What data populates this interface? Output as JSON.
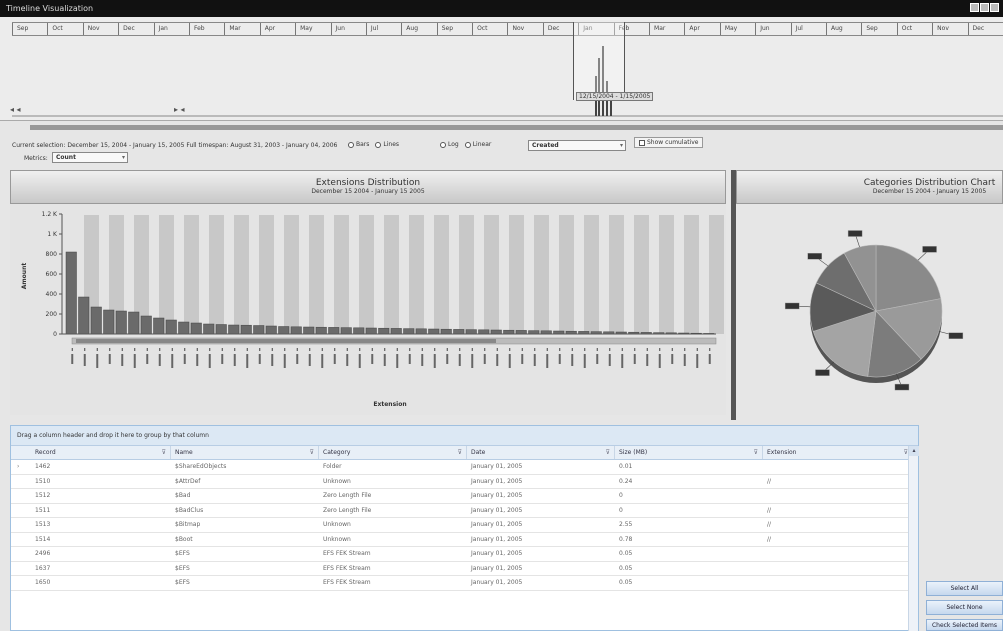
{
  "window": {
    "title": "Timeline Visualization"
  },
  "timeline": {
    "months": [
      "Sep",
      "Oct",
      "Nov",
      "Dec",
      "Jan",
      "Feb",
      "Mar",
      "Apr",
      "May",
      "Jun",
      "Jul",
      "Aug",
      "Sep",
      "Oct",
      "Nov",
      "Dec",
      "Jan",
      "Feb",
      "Mar",
      "Apr",
      "May",
      "Jun",
      "Jul",
      "Aug",
      "Sep",
      "Oct",
      "Nov",
      "Dec"
    ],
    "selection_label": "12/15/2004 - 1/15/2005",
    "arrows": {
      "left": "◂ ◂",
      "mid": "▸ ◂",
      "right": "▸"
    }
  },
  "controls": {
    "selection_text": "Current selection: December 15, 2004 - January 15, 2005   Full timespan: August 31, 2003 - January 04, 2006",
    "bar_options": [
      {
        "label": "Bars",
        "on": true
      },
      {
        "label": "Lines",
        "on": false
      }
    ],
    "scale_options": [
      {
        "label": "Log",
        "on": true
      },
      {
        "label": "Linear",
        "on": false
      }
    ],
    "date_field": "Created",
    "show_cumulative": "Show cumulative",
    "metrics_label": "Metrics:",
    "metrics_value": "Count"
  },
  "ext_chart": {
    "title": "Extensions Distribution",
    "subtitle": "December 15 2004 - January 15 2005",
    "ylabel": "Amount",
    "xlabel": "Extension"
  },
  "cat_chart": {
    "title": "Categories Distribution Chart",
    "subtitle": "December 15 2004 - January 15 2005"
  },
  "chart_data": {
    "type": "bar",
    "y_ticks": [
      "1.2 K",
      "1 K",
      "800",
      "600",
      "400",
      "200",
      "0"
    ],
    "ylim": [
      0,
      1200
    ],
    "values": [
      820,
      370,
      270,
      240,
      230,
      220,
      180,
      160,
      140,
      120,
      110,
      100,
      95,
      90,
      88,
      85,
      80,
      75,
      72,
      70,
      68,
      66,
      64,
      62,
      60,
      58,
      56,
      54,
      52,
      50,
      48,
      46,
      44,
      42,
      40,
      38,
      36,
      34,
      32,
      30,
      28,
      26,
      24,
      22,
      20,
      18,
      16,
      14,
      12,
      10,
      8,
      6
    ]
  },
  "pie": {
    "slices": [
      0.22,
      0.16,
      0.14,
      0.18,
      0.12,
      0.1,
      0.08
    ]
  },
  "grid": {
    "group_hint": "Drag a column header and drop it here to group by that column",
    "columns": [
      "Record",
      "Name",
      "Category",
      "Date",
      "Size (MB)",
      "Extension"
    ],
    "rows": [
      [
        "1462",
        "$ShareEdObjects",
        "Folder",
        "January 01, 2005",
        "0.01",
        ""
      ],
      [
        "1510",
        "$AttrDef",
        "Unknown",
        "January 01, 2005",
        "0.24",
        "//"
      ],
      [
        "1512",
        "$Bad",
        "Zero Length File",
        "January 01, 2005",
        "0",
        ""
      ],
      [
        "1511",
        "$BadClus",
        "Zero Length File",
        "January 01, 2005",
        "0",
        "//"
      ],
      [
        "1513",
        "$Bitmap",
        "Unknown",
        "January 01, 2005",
        "2.55",
        "//"
      ],
      [
        "1514",
        "$Boot",
        "Unknown",
        "January 01, 2005",
        "0.78",
        "//"
      ],
      [
        "2496",
        "$EFS",
        "EFS FEK Stream",
        "January 01, 2005",
        "0.05",
        ""
      ],
      [
        "1637",
        "$EFS",
        "EFS FEK Stream",
        "January 01, 2005",
        "0.05",
        ""
      ],
      [
        "1650",
        "$EFS",
        "EFS FEK Stream",
        "January 01, 2005",
        "0.05",
        ""
      ]
    ]
  },
  "buttons": {
    "select_all": "Select All",
    "select_none": "Select None",
    "check_selected": "Check Selected Items"
  }
}
